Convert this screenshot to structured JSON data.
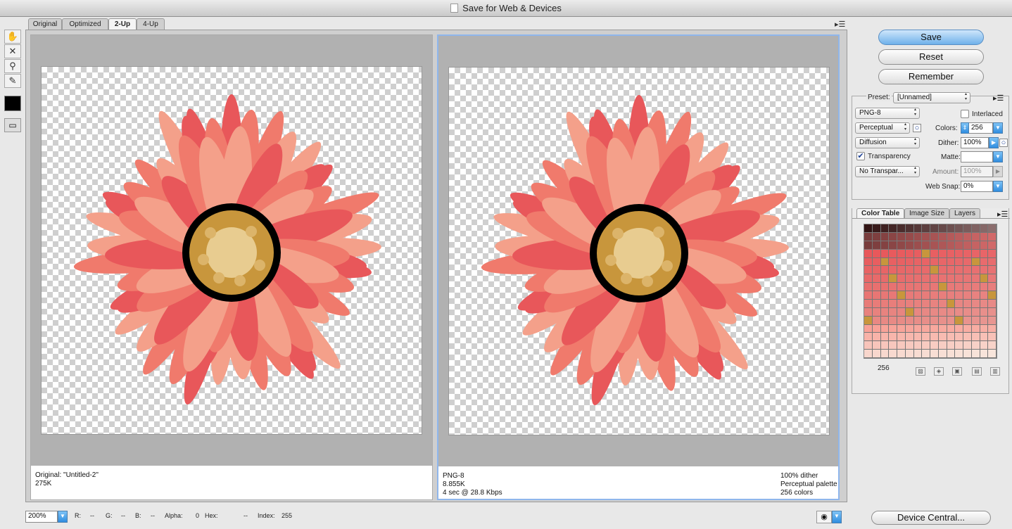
{
  "window": {
    "title": "Save for Web & Devices"
  },
  "tabs": [
    "Original",
    "Optimized",
    "2-Up",
    "4-Up"
  ],
  "active_tab": "2-Up",
  "tools": [
    {
      "icon": "hand-icon",
      "glyph": "✋"
    },
    {
      "icon": "slice-select-icon",
      "glyph": "✕"
    },
    {
      "icon": "zoom-icon",
      "glyph": "⚲"
    },
    {
      "icon": "eyedropper-icon",
      "glyph": "✎"
    }
  ],
  "left_pane": {
    "line1": "Original: \"Untitled-2\"",
    "line2": "275K"
  },
  "right_pane": {
    "line1": "PNG-8",
    "line2": "8.855K",
    "line3": "4 sec @ 28.8 Kbps",
    "right1": "100% dither",
    "right2": "Perceptual palette",
    "right3": "256 colors"
  },
  "buttons": {
    "save": "Save",
    "reset": "Reset",
    "remember": "Remember",
    "device_central": "Device Central..."
  },
  "settings": {
    "preset_label": "Preset:",
    "preset_value": "[Unnamed]",
    "format": "PNG-8",
    "reduction": "Perceptual",
    "dither_algo": "Diffusion",
    "transparency_label": "Transparency",
    "transparency_checked": true,
    "transparency_dither": "No Transpar...",
    "interlaced_label": "Interlaced",
    "interlaced_checked": false,
    "colors_label": "Colors:",
    "colors_value": "256",
    "dither_label": "Dither:",
    "dither_value": "100%",
    "matte_label": "Matte:",
    "matte_value": "",
    "amount_label": "Amount:",
    "amount_value": "100%",
    "websnap_label": "Web Snap:",
    "websnap_value": "0%"
  },
  "panel_tabs": [
    "Color Table",
    "Image Size",
    "Layers"
  ],
  "color_table": {
    "count": "256"
  },
  "status": {
    "zoom": "200%",
    "r_label": "R:",
    "r_value": "--",
    "g_label": "G:",
    "g_value": "--",
    "b_label": "B:",
    "b_value": "--",
    "alpha_label": "Alpha:",
    "alpha_value": "0",
    "hex_label": "Hex:",
    "hex_value": "--",
    "index_label": "Index:",
    "index_value": "255"
  },
  "colors": {
    "accent": "#6fb1ea",
    "petal_dark": "#e8575a",
    "petal_mid": "#f07a6c",
    "petal_light": "#f4a08a",
    "center_gold": "#c8963c",
    "center_light": "#e8cc90"
  }
}
